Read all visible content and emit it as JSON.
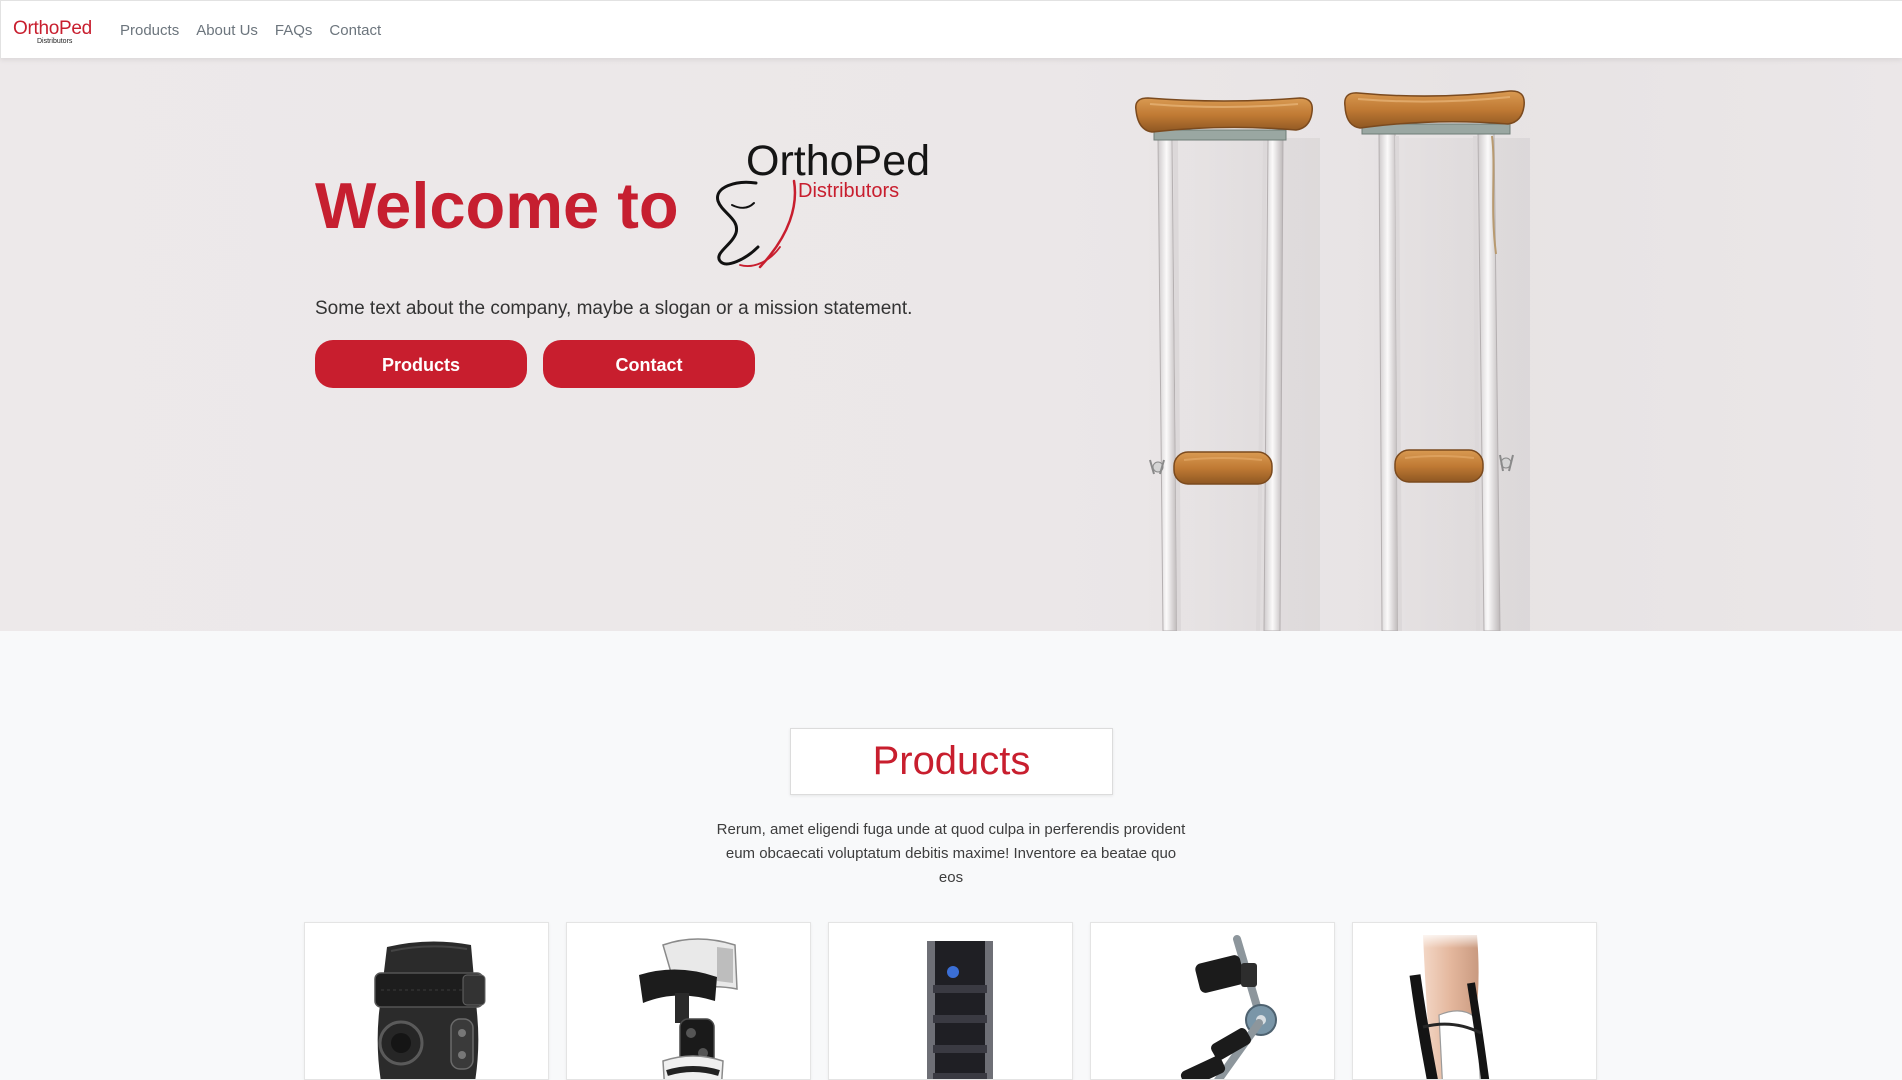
{
  "nav": {
    "logo_name": "OrthoPed",
    "logo_sub": "Distributors",
    "links": [
      {
        "label": "Products"
      },
      {
        "label": "About Us"
      },
      {
        "label": "FAQs"
      },
      {
        "label": "Contact"
      }
    ]
  },
  "hero": {
    "heading": "Welcome to",
    "logo_name": "OrthoPed",
    "logo_sub": "Distributors",
    "tagline": "Some text about the company, maybe a slogan or a mission statement.",
    "buttons": {
      "products": "Products",
      "contact": "Contact"
    },
    "image": "crutches-image"
  },
  "products_section": {
    "title": "Products",
    "description_lines": [
      "Rerum, amet eligendi fuga unde at quod culpa in perferendis provident",
      "eum obcaecati voluptatum debitis maxime! Inventore ea beatae quo",
      "eos"
    ],
    "cards": [
      {
        "icon": "knee-brace-image"
      },
      {
        "icon": "hinged-knee-brace-image"
      },
      {
        "icon": "walking-boot-image"
      },
      {
        "icon": "hinged-leg-brace-image"
      },
      {
        "icon": "ankle-foot-orthosis-image"
      }
    ]
  },
  "colors": {
    "brand_red": "#c81e2e",
    "heading_red": "#c61f30",
    "nav_link": "#6c757d",
    "hero_bg": "#ebe7e8",
    "section_bg": "#f8f9fa",
    "card_bg": "#ffffff"
  }
}
